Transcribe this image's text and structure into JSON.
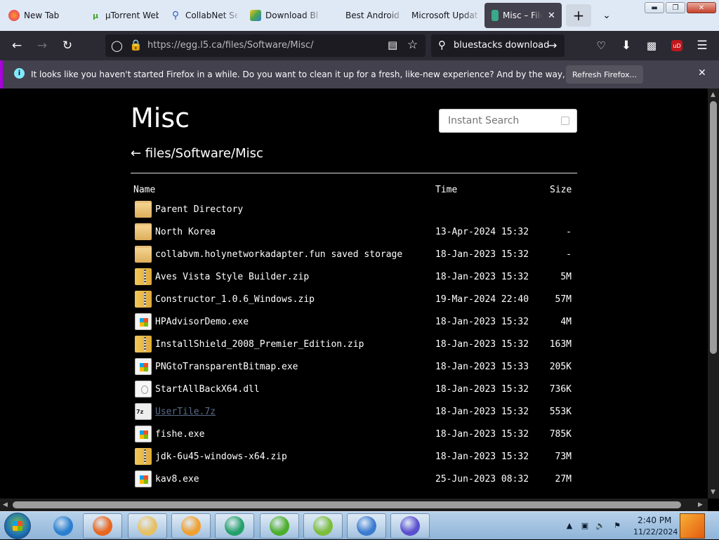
{
  "tabs": [
    {
      "label": "New Tab",
      "icon": "firefox-icon",
      "active": false
    },
    {
      "label": "µTorrent Web",
      "icon": "utorrent-icon",
      "active": false
    },
    {
      "label": "CollabNet Se",
      "icon": "search-icon",
      "active": false
    },
    {
      "label": "Download Bl",
      "icon": "bluestacks-icon",
      "active": false
    },
    {
      "label": "Best Android",
      "icon": "",
      "active": false
    },
    {
      "label": "Microsoft Update",
      "icon": "",
      "active": false
    },
    {
      "label": "Misc – File",
      "icon": "book-icon",
      "active": true
    }
  ],
  "toolbar": {
    "url": "https://egg.l5.ca/files/Software/Misc/",
    "search_text": "bluestacks download",
    "profile_badge": "uD"
  },
  "notification": {
    "message": "It looks like you haven't started Firefox in a while. Do you want to clean it up for a fresh, like-new experience? And by the way, welcome back!",
    "button_label": "Refresh Firefox...",
    "info_icon": "i"
  },
  "listing": {
    "title": "Misc",
    "breadcrumb": "← files/Software/Misc",
    "search_placeholder": "Instant Search",
    "columns": {
      "name": "Name",
      "time": "Time",
      "size": "Size"
    },
    "rows": [
      {
        "name": "Parent Directory",
        "time": "",
        "size": "",
        "type": "folder",
        "visited": false
      },
      {
        "name": "North Korea",
        "time": "13-Apr-2024 15:32",
        "size": "-",
        "type": "folder",
        "visited": false
      },
      {
        "name": "collabvm.holynetworkadapter.fun saved storage",
        "time": "18-Jan-2023 15:32",
        "size": "-",
        "type": "folder",
        "visited": false
      },
      {
        "name": "Aves Vista Style Builder.zip",
        "time": "18-Jan-2023 15:32",
        "size": "5M",
        "type": "zip",
        "visited": false
      },
      {
        "name": "Constructor_1.0.6_Windows.zip",
        "time": "19-Mar-2024 22:40",
        "size": "57M",
        "type": "zip",
        "visited": false
      },
      {
        "name": "HPAdvisorDemo.exe",
        "time": "18-Jan-2023 15:32",
        "size": "4M",
        "type": "exe",
        "visited": false
      },
      {
        "name": "InstallShield_2008_Premier_Edition.zip",
        "time": "18-Jan-2023 15:32",
        "size": "163M",
        "type": "zip",
        "visited": false
      },
      {
        "name": "PNGtoTransparentBitmap.exe",
        "time": "18-Jan-2023 15:33",
        "size": "205K",
        "type": "exe",
        "visited": false
      },
      {
        "name": "StartAllBackX64.dll",
        "time": "18-Jan-2023 15:32",
        "size": "736K",
        "type": "dll",
        "visited": false
      },
      {
        "name": "UserTile.7z",
        "time": "18-Jan-2023 15:32",
        "size": "553K",
        "type": "7z",
        "visited": true
      },
      {
        "name": "fishe.exe",
        "time": "18-Jan-2023 15:32",
        "size": "785K",
        "type": "exe",
        "visited": false
      },
      {
        "name": "jdk-6u45-windows-x64.zip",
        "time": "18-Jan-2023 15:32",
        "size": "73M",
        "type": "zip",
        "visited": false
      },
      {
        "name": "kav8.exe",
        "time": "25-Jun-2023 08:32",
        "size": "27M",
        "type": "exe",
        "visited": false
      }
    ]
  },
  "taskbar": {
    "apps": [
      {
        "name": "ie-icon",
        "open": false,
        "color": "#2a7fd0"
      },
      {
        "name": "firefox-icon",
        "open": true,
        "color": "#e8661f"
      },
      {
        "name": "explorer-folder-icon",
        "open": true,
        "color": "#e6c063"
      },
      {
        "name": "media-player-icon",
        "open": true,
        "color": "#f0a030"
      },
      {
        "name": "browser-globe-icon",
        "open": true,
        "color": "#25a06a"
      },
      {
        "name": "utorrent-icon",
        "open": true,
        "color": "#4caf2c"
      },
      {
        "name": "bluestacks-icon",
        "open": true,
        "color": "#7cbd3b"
      },
      {
        "name": "control-panel-icon",
        "open": true,
        "color": "#3b7bd0"
      },
      {
        "name": "infinity-app-icon",
        "open": true,
        "color": "#5b4fd0"
      }
    ],
    "clock_time": "2:40 PM",
    "clock_date": "11/22/2024"
  }
}
